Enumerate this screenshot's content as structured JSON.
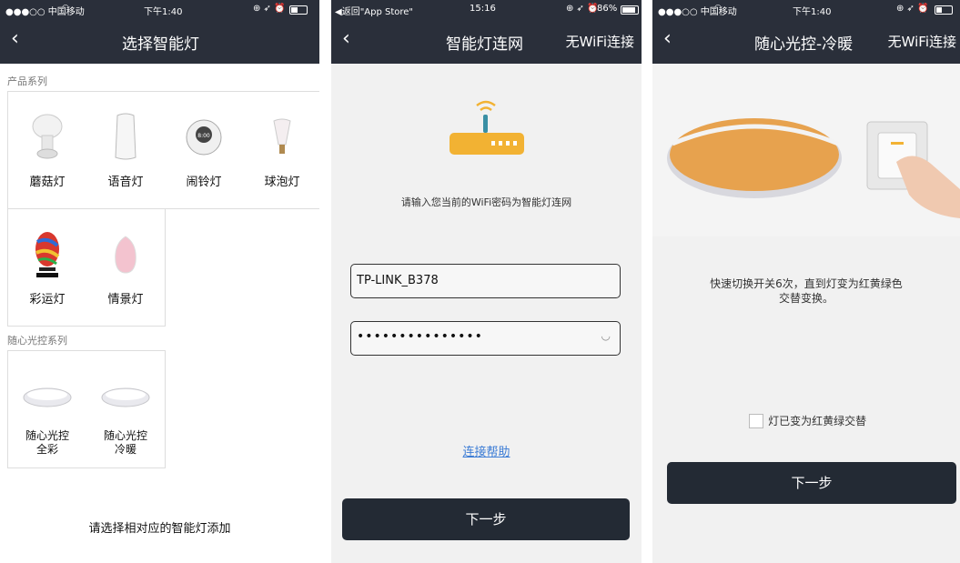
{
  "screen1": {
    "status": {
      "carrier": "●●●○○ 中国移动",
      "time": "下午1:40"
    },
    "nav": {
      "back": "‹",
      "title": "选择智能灯"
    },
    "section_products": "产品系列",
    "products": [
      {
        "label": "蘑菇灯",
        "icon": "mushroom-lamp-icon"
      },
      {
        "label": "语音灯",
        "icon": "voice-lamp-icon"
      },
      {
        "label": "闹铃灯",
        "icon": "alarm-lamp-icon"
      },
      {
        "label": "球泡灯",
        "icon": "bulb-lamp-icon"
      },
      {
        "label": "彩运灯",
        "icon": "color-lamp-icon"
      },
      {
        "label": "情景灯",
        "icon": "scene-lamp-icon"
      }
    ],
    "section_control": "随心光控系列",
    "control": [
      {
        "line1": "随心光控",
        "line2": "全彩",
        "icon": "ceiling-lamp-icon"
      },
      {
        "line1": "随心光控",
        "line2": "冷暖",
        "icon": "ceiling-lamp-icon"
      }
    ],
    "footer": "请选择相对应的智能灯添加"
  },
  "screen2": {
    "status": {
      "back_app": "◀返回\"App Store\"",
      "time": "15:16",
      "battery": "86%"
    },
    "nav": {
      "back": "‹",
      "title": "智能灯连网",
      "right": "无WiFi连接"
    },
    "instruction": "请输入您当前的WiFi密码为智能灯连网",
    "ssid_value": "TP-LINK_B378",
    "password_value": "•••••••••••••••",
    "help_link": "连接帮助",
    "next": "下一步"
  },
  "screen3": {
    "status": {
      "carrier": "●●●○○ 中国移动",
      "time": "下午1:40"
    },
    "nav": {
      "back": "‹",
      "title": "随心光控-冷暖",
      "right": "无WiFi连接"
    },
    "instruction_line1": "快速切换开关6次，直到灯变为红黄绿色",
    "instruction_line2": "交替变换。",
    "checkbox_label": "灯已变为红黄绿交替",
    "next": "下一步"
  }
}
